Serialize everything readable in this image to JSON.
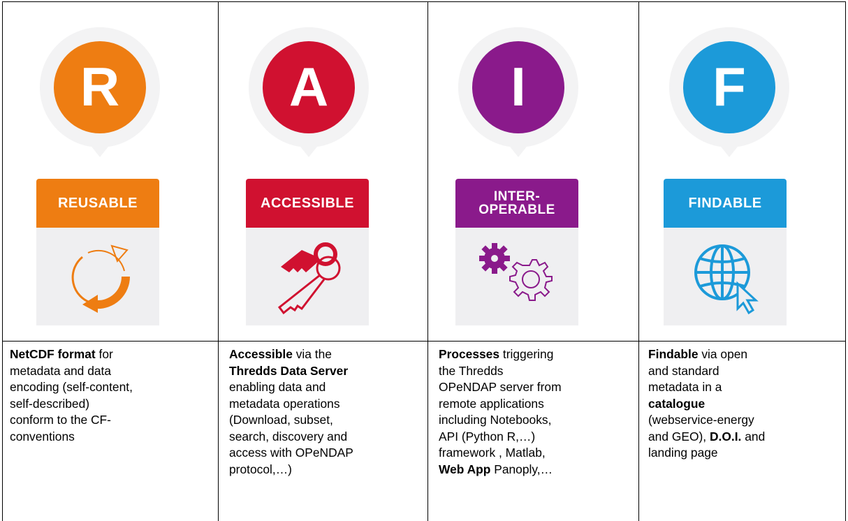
{
  "columns": [
    {
      "letter": "R",
      "color": "#ee7d12",
      "label_lines": [
        "REUSABLE"
      ],
      "icon": "refresh-arrows-icon",
      "text": [
        {
          "b": true,
          "t": "NetCDF format"
        },
        {
          "b": false,
          "t": " for metadata and data encoding (self-content, self-described) conform to the CF-conventions"
        }
      ]
    },
    {
      "letter": "A",
      "color": "#d01130",
      "label_lines": [
        "ACCESSIBLE"
      ],
      "icon": "keys-icon",
      "text": [
        {
          "b": true,
          "t": "Accessible"
        },
        {
          "b": false,
          "t": " via the "
        },
        {
          "b": true,
          "t": "Thredds Data Server"
        },
        {
          "b": false,
          "t": " enabling data and metadata operations (Download, subset, search, discovery and access with OPeNDAP protocol,…)"
        }
      ]
    },
    {
      "letter": "I",
      "color": "#8a1a8b",
      "label_lines": [
        "INTER-",
        "OPERABLE"
      ],
      "icon": "gears-icon",
      "text": [
        {
          "b": true,
          "t": "Processes"
        },
        {
          "b": false,
          "t": " triggering the Thredds OPeNDAP server from remote applications including Notebooks, API (Python R,…) framework , Matlab, "
        },
        {
          "b": true,
          "t": "Web App"
        },
        {
          "b": false,
          "t": " Panoply,…"
        }
      ]
    },
    {
      "letter": "F",
      "color": "#1c9ad9",
      "label_lines": [
        "FINDABLE"
      ],
      "icon": "globe-cursor-icon",
      "text": [
        {
          "b": true,
          "t": "Findable"
        },
        {
          "b": false,
          "t": " via open and standard metadata in a "
        },
        {
          "b": true,
          "t": "catalogue"
        },
        {
          "b": false,
          "t": " (webservice-energy and GEO), "
        },
        {
          "b": true,
          "t": "D.O.I."
        },
        {
          "b": false,
          "t": " and landing page"
        }
      ]
    }
  ]
}
